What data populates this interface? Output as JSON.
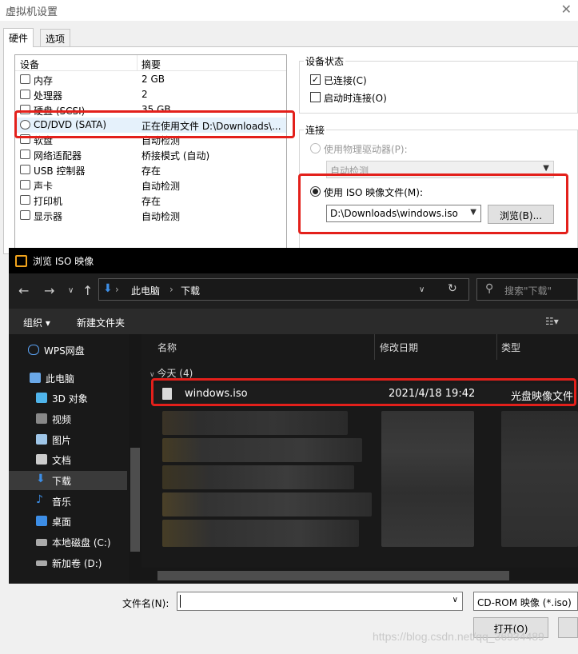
{
  "vm_dialog": {
    "title": "虚拟机设置",
    "tabs": [
      "硬件",
      "选项"
    ],
    "device_list": {
      "headers": [
        "设备",
        "摘要"
      ],
      "rows": [
        {
          "name": "内存",
          "summary": "2 GB"
        },
        {
          "name": "处理器",
          "summary": "2"
        },
        {
          "name": "硬盘 (SCSI)",
          "summary": "35 GB"
        },
        {
          "name": "CD/DVD (SATA)",
          "summary": "正在使用文件 D:\\Downloads\\..."
        },
        {
          "name": "软盘",
          "summary": "自动检测"
        },
        {
          "name": "网络适配器",
          "summary": "桥接模式 (自动)"
        },
        {
          "name": "USB 控制器",
          "summary": "存在"
        },
        {
          "name": "声卡",
          "summary": "自动检测"
        },
        {
          "name": "打印机",
          "summary": "存在"
        },
        {
          "name": "显示器",
          "summary": "自动检测"
        }
      ]
    },
    "device_status": {
      "title": "设备状态",
      "connected": "已连接(C)",
      "connect_at_power_on": "启动时连接(O)"
    },
    "connection": {
      "title": "连接",
      "physical_drive": "使用物理驱动器(P):",
      "physical_drive_value": "自动检测",
      "iso_file": "使用 ISO 映像文件(M):",
      "iso_path": "D:\\Downloads\\windows.iso",
      "browse_button": "浏览(B)..."
    }
  },
  "browse_dialog": {
    "title": "浏览 ISO 映像",
    "breadcrumb": [
      "此电脑",
      "下载"
    ],
    "search_placeholder": "搜索\"下载\"",
    "toolbar": {
      "organize": "组织 ▾",
      "new_folder": "新建文件夹"
    },
    "sidebar": [
      {
        "label": "WPS网盘",
        "icon": "cloud-icon"
      },
      {
        "label": "此电脑",
        "icon": "computer-icon"
      },
      {
        "label": "3D 对象",
        "icon": "cube-icon"
      },
      {
        "label": "视频",
        "icon": "video-icon"
      },
      {
        "label": "图片",
        "icon": "picture-icon"
      },
      {
        "label": "文档",
        "icon": "document-icon"
      },
      {
        "label": "下载",
        "icon": "download-icon"
      },
      {
        "label": "音乐",
        "icon": "music-icon"
      },
      {
        "label": "桌面",
        "icon": "desktop-icon"
      },
      {
        "label": "本地磁盘 (C:)",
        "icon": "disk-icon"
      },
      {
        "label": "新加卷 (D:)",
        "icon": "drive-icon"
      }
    ],
    "columns": [
      "名称",
      "修改日期",
      "类型"
    ],
    "group_label": "今天 (4)",
    "file": {
      "name": "windows.iso",
      "modified": "2021/4/18 19:42",
      "type": "光盘映像文件"
    },
    "file_name_label": "文件名(N):",
    "file_type_value": "CD-ROM 映像 (*.iso)",
    "open_button": "打开(O)"
  },
  "watermark": "https://blog.csdn.net/qq_36934489",
  "colors": {
    "highlight_red": "#e3201b",
    "dark_bg": "#1f1f1f"
  }
}
